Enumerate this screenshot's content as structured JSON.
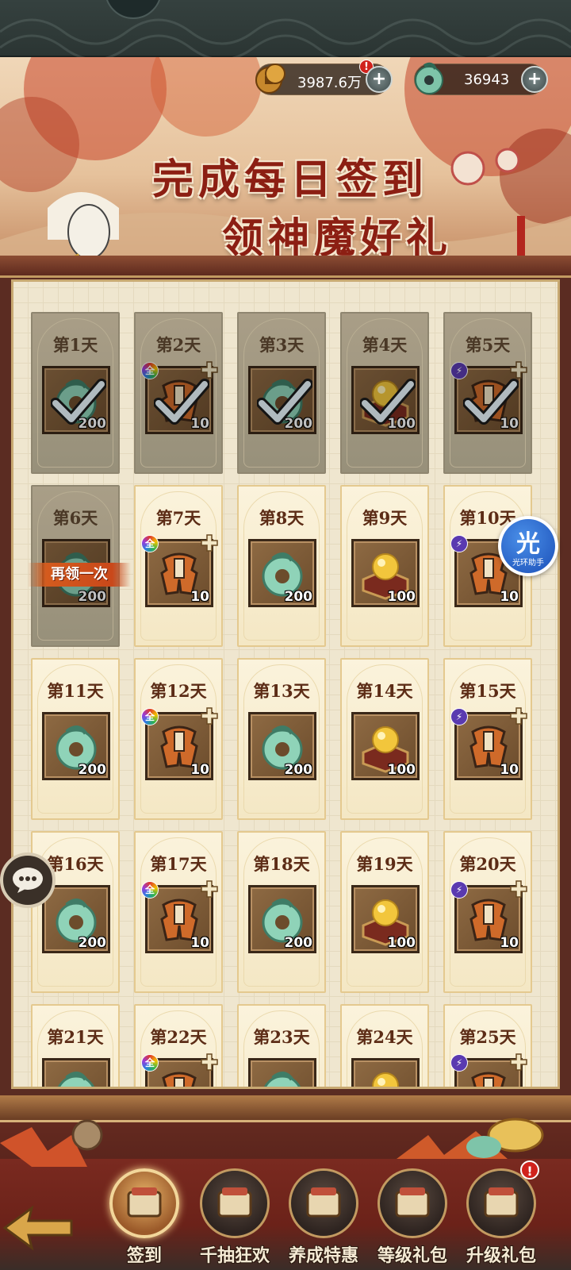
{
  "resources": {
    "coins": {
      "value": "3987.6万",
      "icon": "copper-coins-icon",
      "alert": "!"
    },
    "jade": {
      "value": "36943",
      "icon": "jade-dragon-icon"
    }
  },
  "banner": {
    "title_line1": "完成每日签到",
    "title_line2": "领神魔好礼"
  },
  "days": [
    {
      "label": "第1天",
      "item": "jade",
      "qty": "200",
      "state": "claimed"
    },
    {
      "label": "第2天",
      "item": "armor",
      "qty": "10",
      "badge": "全",
      "state": "claimed"
    },
    {
      "label": "第3天",
      "item": "jade",
      "qty": "200",
      "state": "claimed"
    },
    {
      "label": "第4天",
      "item": "orb",
      "qty": "100",
      "state": "claimed"
    },
    {
      "label": "第5天",
      "item": "armor",
      "qty": "10",
      "badge": "⚡",
      "state": "claimed"
    },
    {
      "label": "第6天",
      "item": "jade",
      "qty": "200",
      "state": "reclaim",
      "reclaim_label": "再领一次"
    },
    {
      "label": "第7天",
      "item": "armor",
      "qty": "10",
      "badge": "全",
      "state": "open"
    },
    {
      "label": "第8天",
      "item": "jade",
      "qty": "200",
      "state": "open"
    },
    {
      "label": "第9天",
      "item": "orb",
      "qty": "100",
      "state": "open"
    },
    {
      "label": "第10天",
      "item": "armor",
      "qty": "10",
      "badge": "⚡",
      "state": "open"
    },
    {
      "label": "第11天",
      "item": "jade",
      "qty": "200",
      "state": "open"
    },
    {
      "label": "第12天",
      "item": "armor",
      "qty": "10",
      "badge": "全",
      "state": "open"
    },
    {
      "label": "第13天",
      "item": "jade",
      "qty": "200",
      "state": "open"
    },
    {
      "label": "第14天",
      "item": "orb",
      "qty": "100",
      "state": "open"
    },
    {
      "label": "第15天",
      "item": "armor",
      "qty": "10",
      "badge": "⚡",
      "state": "open"
    },
    {
      "label": "第16天",
      "item": "jade",
      "qty": "200",
      "state": "open"
    },
    {
      "label": "第17天",
      "item": "armor",
      "qty": "10",
      "badge": "全",
      "state": "open"
    },
    {
      "label": "第18天",
      "item": "jade",
      "qty": "200",
      "state": "open"
    },
    {
      "label": "第19天",
      "item": "orb",
      "qty": "100",
      "state": "open"
    },
    {
      "label": "第20天",
      "item": "armor",
      "qty": "10",
      "badge": "⚡",
      "state": "open"
    },
    {
      "label": "第21天",
      "item": "jade",
      "qty": "",
      "state": "open"
    },
    {
      "label": "第22天",
      "item": "armor",
      "qty": "",
      "badge": "全",
      "state": "open"
    },
    {
      "label": "第23天",
      "item": "jade",
      "qty": "",
      "state": "open"
    },
    {
      "label": "第24天",
      "item": "orb",
      "qty": "",
      "state": "open"
    },
    {
      "label": "第25天",
      "item": "armor",
      "qty": "",
      "badge": "⚡",
      "state": "open"
    }
  ],
  "assistant": {
    "big": "光",
    "small": "光环助手"
  },
  "chat": {
    "icon": "chat-bubble-icon"
  },
  "tabs": [
    {
      "label": "签到",
      "icon": "sign-in-scroll-icon",
      "active": true
    },
    {
      "label": "千抽狂欢",
      "icon": "cards-icon",
      "active": false
    },
    {
      "label": "养成特惠",
      "icon": "treasure-chest-icon",
      "active": false
    },
    {
      "label": "等级礼包",
      "icon": "gift-bag-icon",
      "active": false
    },
    {
      "label": "升级礼包",
      "icon": "treasure-pot-icon",
      "active": false,
      "alert": "!"
    }
  ],
  "colors": {
    "title_red": "#8c1f13",
    "card_cream": "#fbf3dc",
    "claimed_gray": "#a99e87",
    "reclaim_orange": "#d45b1e",
    "frame_brown": "#5b2c22"
  }
}
